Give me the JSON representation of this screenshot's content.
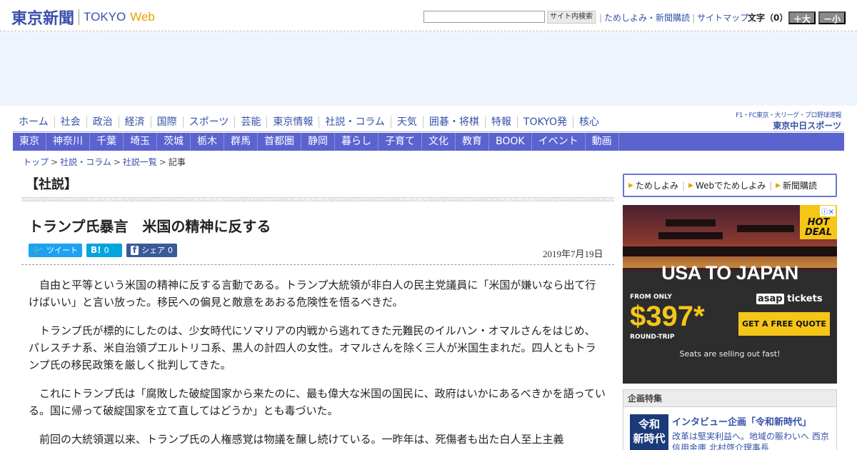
{
  "header": {
    "logo_kanji": "東京新聞",
    "logo_tokyo": "TOKYO",
    "logo_web": "Web",
    "search_button": "サイト内検索",
    "util_links": [
      "ためしよみ・新聞購読",
      "サイトマップ"
    ],
    "font_label": "文字（0）",
    "font_up": "＋大",
    "font_down": "－小"
  },
  "nav_main": [
    "ホーム",
    "社会",
    "政治",
    "経済",
    "国際",
    "スポーツ",
    "芸能",
    "東京情報",
    "社説・コラム",
    "天気",
    "囲碁・将棋",
    "特報",
    "TOKYO発",
    "核心"
  ],
  "chunichi": {
    "top": "F1・FC東京・大リーグ・プロ野球速報",
    "bottom": "東京中日スポーツ"
  },
  "nav_region": [
    "東京",
    "神奈川",
    "千葉",
    "埼玉",
    "茨城",
    "栃木",
    "群馬",
    "首都圏",
    "静岡",
    "暮らし",
    "子育て",
    "文化",
    "教育",
    "BOOK",
    "イベント",
    "動画"
  ],
  "breadcrumb": [
    "トップ",
    "社説・コラム",
    "社説一覧",
    "記事"
  ],
  "article": {
    "section": "【社説】",
    "title": "トランプ氏暴言　米国の精神に反する",
    "date": "2019年7月19日",
    "share": {
      "tweet": "ツイート",
      "hatena_icon": "B!",
      "hatena_count": "0",
      "fb_icon": "f",
      "fb_label": "シェア",
      "fb_count": "0"
    },
    "paragraphs": [
      "自由と平等という米国の精神に反する言動である。トランプ大統領が非白人の民主党議員に「米国が嫌いなら出て行けばいい」と言い放った。移民への偏見と敵意をあおる危険性を悟るべきだ。",
      "トランプ氏が標的にしたのは、少女時代にソマリアの内戦から逃れてきた元難民のイルハン・オマルさんをはじめ、パレスチナ系、米自治領プエルトリコ系、黒人の計四人の女性。オマルさんを除く三人が米国生まれだ。四人ともトランプ氏の移民政策を厳しく批判してきた。",
      "これにトランプ氏は「腐敗した破綻国家から来たのに、最も偉大な米国の国民に、政府はいかにあるべきかを語っている。国に帰って破綻国家を立て直してはどうか」とも毒づいた。",
      "前回の大統領選以来、トランプ氏の人権感覚は物議を醸し続けている。一昨年は、死傷者も出た白人至上主義"
    ]
  },
  "sidebar": {
    "links": [
      "ためしよみ",
      "Webでためしよみ",
      "新聞購読"
    ],
    "ad": {
      "deal": "HOT DEAL",
      "headline": "USA TO JAPAN",
      "from": "FROM ONLY",
      "price": "$397*",
      "trip": "ROUND-TRIP",
      "brand_a": "asap",
      "brand_b": "tickets",
      "cta": "GET A FREE QUOTE",
      "tagline": "Seats are selling out fast!"
    },
    "kikaku": {
      "header": "企画特集",
      "thumb_line1": "令和",
      "thumb_line2": "新時代",
      "title": "インタビュー企画「令和新時代」",
      "desc": "改革は堅実利益へ。地域の賑わいへ 西京信用金庫 北村啓介理事長"
    }
  },
  "colors": {
    "brand_blue": "#3a4fae",
    "nav_band": "#5b63cf",
    "ad_band": "#eef4fd",
    "accent_orange": "#e8a100"
  }
}
